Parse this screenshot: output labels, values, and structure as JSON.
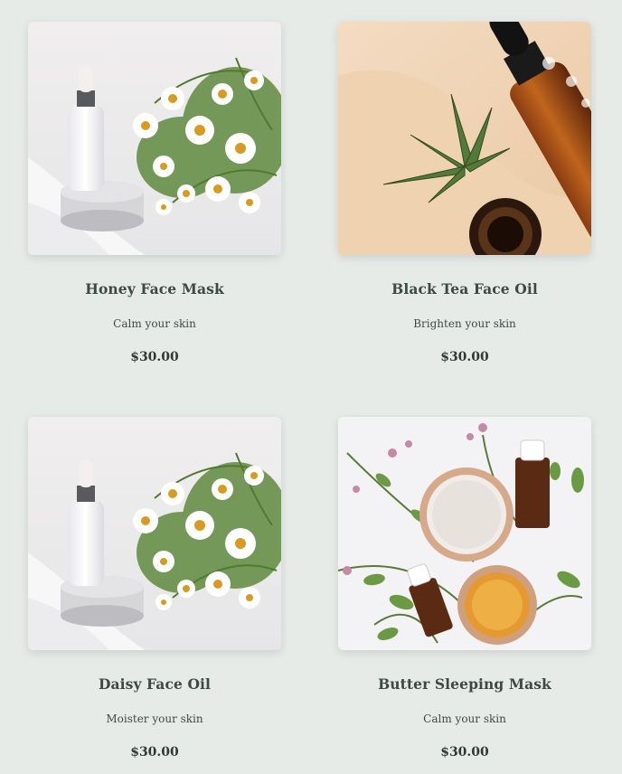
{
  "products": [
    {
      "name": "Honey Face Mask",
      "tagline": "Calm your skin",
      "price": "$30.00",
      "image": "white-dropper-bottle-with-daisies-photo"
    },
    {
      "name": "Black Tea Face Oil",
      "tagline": "Brighten your skin",
      "price": "$30.00",
      "image": "amber-dropper-bottle-with-leaf-photo"
    },
    {
      "name": "Daisy Face Oil",
      "tagline": "Moister your skin",
      "price": "$30.00",
      "image": "white-dropper-bottle-with-daisies-photo"
    },
    {
      "name": "Butter Sleeping Mask",
      "tagline": "Calm your skin",
      "price": "$30.00",
      "image": "clay-and-honey-bowls-with-herbs-photo"
    }
  ],
  "colors": {
    "page_background": "#e7ebe8",
    "text": "#2f3a34"
  }
}
